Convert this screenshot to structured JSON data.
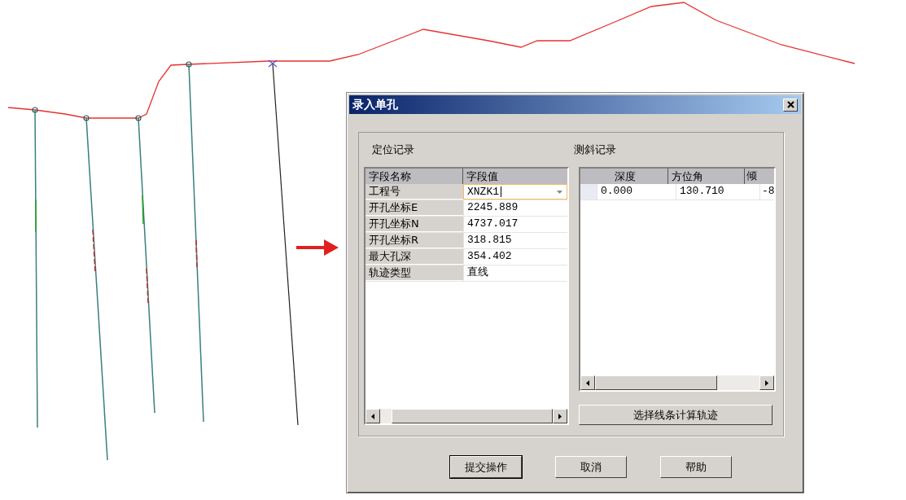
{
  "window": {
    "title": "录入单孔"
  },
  "location": {
    "label": "定位记录",
    "columns": [
      "字段名称",
      "字段值"
    ],
    "rows": [
      {
        "name": "工程号",
        "value": "XNZK1",
        "kind": "combo"
      },
      {
        "name": "开孔坐标E",
        "value": "2245.889",
        "kind": "text"
      },
      {
        "name": "开孔坐标N",
        "value": "4737.017",
        "kind": "text"
      },
      {
        "name": "开孔坐标R",
        "value": "318.815",
        "kind": "text"
      },
      {
        "name": "最大孔深",
        "value": "354.402",
        "kind": "text"
      },
      {
        "name": "轨迹类型",
        "value": "直线",
        "kind": "text"
      }
    ]
  },
  "inclination": {
    "label": "测斜记录",
    "columns": [
      "深度",
      "方位角",
      "倾"
    ],
    "rows": [
      [
        "0.000",
        "130.710",
        "-8"
      ]
    ],
    "action_button": "选择线条计算轨迹"
  },
  "buttons": [
    {
      "label": "提交操作",
      "default": true
    },
    {
      "label": "取消",
      "default": false
    },
    {
      "label": "帮助",
      "default": false
    }
  ]
}
